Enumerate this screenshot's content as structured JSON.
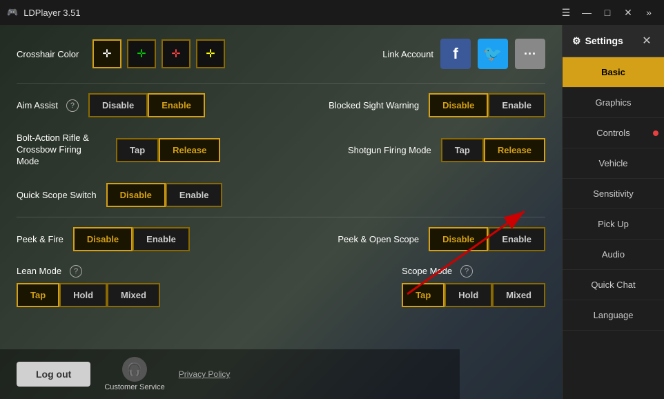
{
  "titleBar": {
    "appName": "LDPlayer 3.51",
    "iconSymbol": "🎮",
    "controls": {
      "menu": "☰",
      "minimize": "—",
      "maximize": "□",
      "close": "✕",
      "extra": "»"
    }
  },
  "settings": {
    "title": "Settings",
    "gearIcon": "⚙",
    "closeIcon": "✕",
    "navItems": [
      {
        "id": "basic",
        "label": "Basic",
        "active": true,
        "hasDot": false
      },
      {
        "id": "graphics",
        "label": "Graphics",
        "active": false,
        "hasDot": false
      },
      {
        "id": "controls",
        "label": "Controls",
        "active": false,
        "hasDot": true
      },
      {
        "id": "vehicle",
        "label": "Vehicle",
        "active": false,
        "hasDot": false
      },
      {
        "id": "sensitivity",
        "label": "Sensitivity",
        "active": false,
        "hasDot": false
      },
      {
        "id": "pickup",
        "label": "Pick Up",
        "active": false,
        "hasDot": false
      },
      {
        "id": "audio",
        "label": "Audio",
        "active": false,
        "hasDot": false
      },
      {
        "id": "quickchat",
        "label": "Quick Chat",
        "active": false,
        "hasDot": false
      },
      {
        "id": "language",
        "label": "Language",
        "active": false,
        "hasDot": false
      }
    ]
  },
  "content": {
    "crosshairColor": {
      "label": "Crosshair Color",
      "options": [
        {
          "symbol": "✛",
          "selected": true,
          "color": "#ffffff"
        },
        {
          "symbol": "✛",
          "selected": false,
          "color": "#00cc00"
        },
        {
          "symbol": "✛",
          "selected": false,
          "color": "#ff4444"
        },
        {
          "symbol": "✛",
          "selected": false,
          "color": "#ffff00"
        }
      ]
    },
    "linkAccount": {
      "label": "Link Account"
    },
    "aimAssist": {
      "label": "Aim Assist",
      "hasHelp": true,
      "options": [
        "Disable",
        "Enable"
      ],
      "selected": "Enable"
    },
    "blockedSightWarning": {
      "label": "Blocked Sight Warning",
      "options": [
        "Disable",
        "Enable"
      ],
      "selected": "Disable"
    },
    "boltAction": {
      "label": "Bolt-Action Rifle & Crossbow Firing Mode",
      "options": [
        "Tap",
        "Release"
      ],
      "selected": "Release"
    },
    "shotgunFiringMode": {
      "label": "Shotgun Firing Mode",
      "options": [
        "Tap",
        "Release"
      ],
      "selected": "Release"
    },
    "quickScopeSwitch": {
      "label": "Quick Scope Switch",
      "options": [
        "Disable",
        "Enable"
      ],
      "selected": "Disable"
    },
    "peekFire": {
      "label": "Peek & Fire",
      "options": [
        "Disable",
        "Enable"
      ],
      "selected": "Disable"
    },
    "peekOpenScope": {
      "label": "Peek & Open Scope",
      "options": [
        "Disable",
        "Enable"
      ],
      "selected": "Disable"
    },
    "leanMode": {
      "label": "Lean Mode",
      "hasHelp": true,
      "options": [
        "Tap",
        "Hold",
        "Mixed"
      ],
      "selected": "Tap"
    },
    "scopeMode": {
      "label": "Scope Mode",
      "hasHelp": true,
      "options": [
        "Tap",
        "Hold",
        "Mixed"
      ],
      "selected": "Tap"
    }
  },
  "bottomBar": {
    "logoutLabel": "Log out",
    "customerService": "Customer Service",
    "privacyPolicy": "Privacy Policy"
  },
  "annotation": {
    "arrowTarget": "controls",
    "arrowColor": "#cc0000"
  }
}
